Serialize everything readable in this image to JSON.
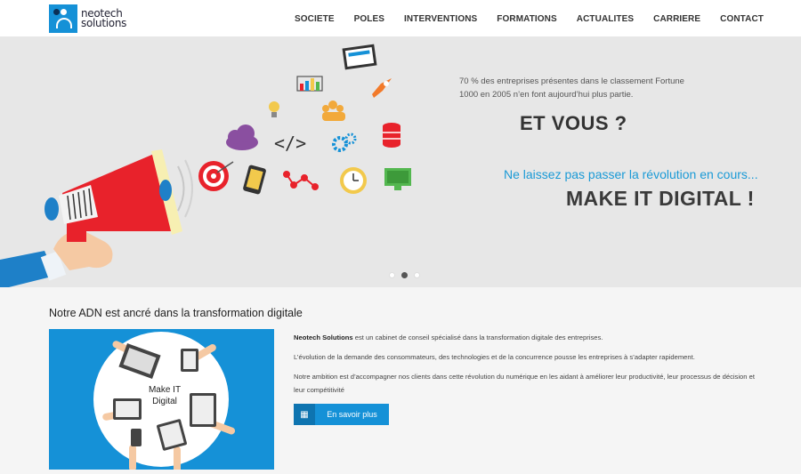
{
  "brand": {
    "line1": "neotech",
    "line2": "solutions"
  },
  "nav": [
    {
      "label": "SOCIETE"
    },
    {
      "label": "POLES"
    },
    {
      "label": "INTERVENTIONS"
    },
    {
      "label": "FORMATIONS"
    },
    {
      "label": "ACTUALITES"
    },
    {
      "label": "CARRIERE"
    },
    {
      "label": "CONTACT"
    }
  ],
  "hero": {
    "stat_line1": "70 % des entreprises présentes dans le classement Fortune",
    "stat_line2": "1000 en 2005 n’en font aujourd’hui plus partie.",
    "headline": "ET VOUS ?",
    "subline": "Ne laissez pas passer la révolution en cours...",
    "tagline": "MAKE IT DIGITAL !",
    "code_symbol": "</>",
    "slider_active_index": 1,
    "slider_count": 3
  },
  "section": {
    "title": "Notre ADN est ancré dans la transformation digitale",
    "illustration_label_1": "Make IT",
    "illustration_label_2": "Digital",
    "company": "Neotech Solutions",
    "p1_rest": " est un cabinet de conseil spécialisé dans la transformation digitale des entreprises.",
    "p2": "L’évolution de la demande des consommateurs, des technologies et de la concurrence pousse les entreprises à s’adapter rapidement.",
    "p3": "Notre ambition est d’accompagner nos clients dans cette révolution du numérique en les aidant à améliorer leur productivité, leur processus de décision et leur compétitivité",
    "button_label": "En savoir plus",
    "button_icon": "puzzle-icon"
  },
  "colors": {
    "accent": "#1591d7",
    "hero_bg": "#e7e7e7",
    "megaphone_red": "#e8222b",
    "subline_blue": "#1a9ad6"
  }
}
